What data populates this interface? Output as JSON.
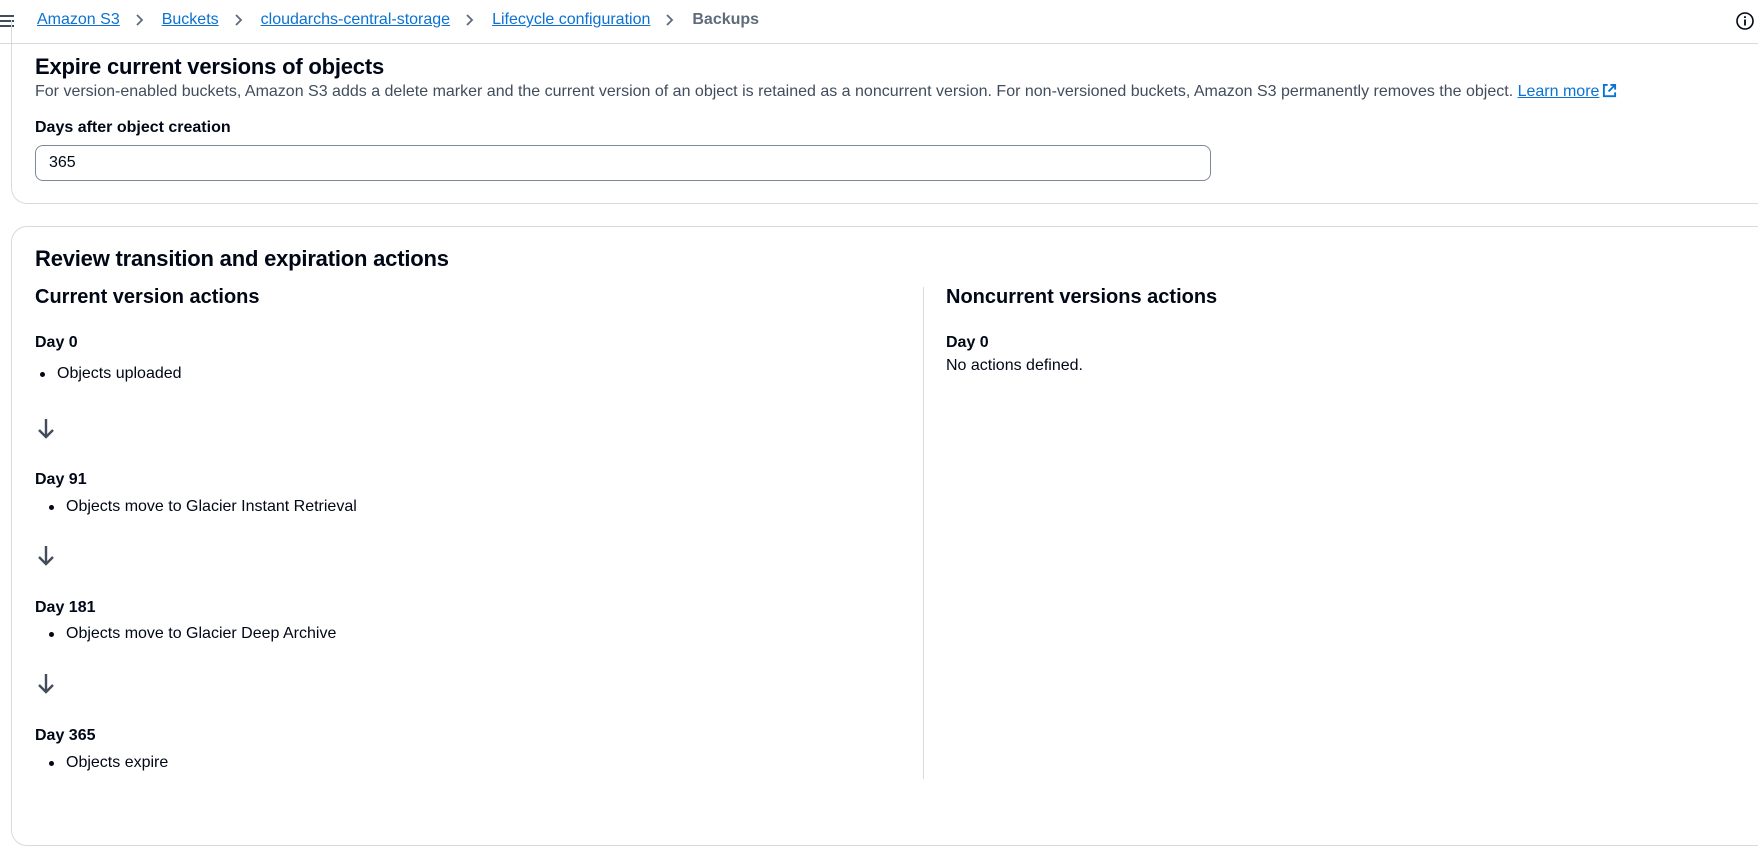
{
  "breadcrumb": {
    "items": [
      "Amazon S3",
      "Buckets",
      "cloudarchs-central-storage",
      "Lifecycle configuration"
    ],
    "current": "Backups"
  },
  "expire_section": {
    "title": "Expire current versions of objects",
    "description": "For version-enabled buckets, Amazon S3 adds a delete marker and the current version of an object is retained as a noncurrent version. For non-versioned buckets, Amazon S3 permanently removes the object.",
    "learn_more": "Learn more",
    "field_label": "Days after object creation",
    "field_value": "365"
  },
  "review": {
    "title": "Review transition and expiration actions",
    "current": {
      "title": "Current version actions",
      "steps": [
        {
          "day": "Day 0",
          "action": "Objects uploaded"
        },
        {
          "day": "Day 91",
          "action": "Objects move to Glacier Instant Retrieval"
        },
        {
          "day": "Day 181",
          "action": "Objects move to Glacier Deep Archive"
        },
        {
          "day": "Day 365",
          "action": "Objects expire"
        }
      ]
    },
    "noncurrent": {
      "title": "Noncurrent versions actions",
      "day": "Day 0",
      "text": "No actions defined."
    }
  },
  "icons": {
    "menu": "hamburger-menu-icon",
    "breadcrumb_separator": "chevron-right-icon",
    "info": "info-icon",
    "external_link": "external-link-icon",
    "arrow": "arrow-down-icon"
  },
  "colors": {
    "link": "#0972d3",
    "text": "#000716",
    "secondary_text": "#414d5c",
    "border": "#d5dbdb",
    "muted": "#5f6b7a"
  }
}
